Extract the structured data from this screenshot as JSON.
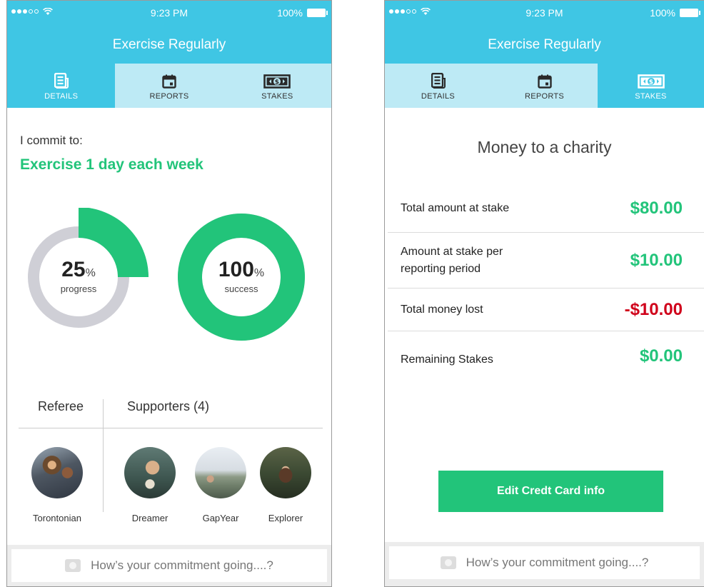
{
  "status": {
    "time": "9:23 PM",
    "battery": "100%"
  },
  "app": {
    "title": "Exercise Regularly"
  },
  "tabs": [
    {
      "label": "DETAILS",
      "icon": "newspaper-icon"
    },
    {
      "label": "REPORTS",
      "icon": "calendar-icon"
    },
    {
      "label": "STAKES",
      "icon": "money-icon"
    }
  ],
  "details": {
    "commit_label": "I commit to:",
    "commit_goal": "Exercise 1 day each week",
    "progress": {
      "value": "25",
      "unit": "%",
      "label": "progress",
      "fraction": 0.25
    },
    "success": {
      "value": "100",
      "unit": "%",
      "label": "success",
      "fraction": 1.0
    },
    "referee_title": "Referee",
    "supporters_title": "Supporters (4)",
    "referee": {
      "name": "Torontonian"
    },
    "supporters": [
      {
        "name": "Dreamer"
      },
      {
        "name": "GapYear"
      },
      {
        "name": "Explorer"
      }
    ]
  },
  "stakes": {
    "title": "Money to a charity",
    "rows": [
      {
        "label": "Total amount at stake",
        "value": "$80.00"
      },
      {
        "label": "Amount at stake per reporting period",
        "value": "$10.00"
      },
      {
        "label": "Total money lost",
        "value": "-$10.00"
      },
      {
        "label": "Remaining Stakes",
        "value": "$0.00"
      }
    ],
    "edit_button": "Edit Credt Card info"
  },
  "compose": {
    "placeholder": "How’s your commitment going....?"
  },
  "colors": {
    "header": "#3fc6e4",
    "tab_inactive": "#bdeaf5",
    "accent_green": "#22c47a",
    "negative_red": "#d0021b",
    "ring_gray": "#cfcfd6"
  }
}
